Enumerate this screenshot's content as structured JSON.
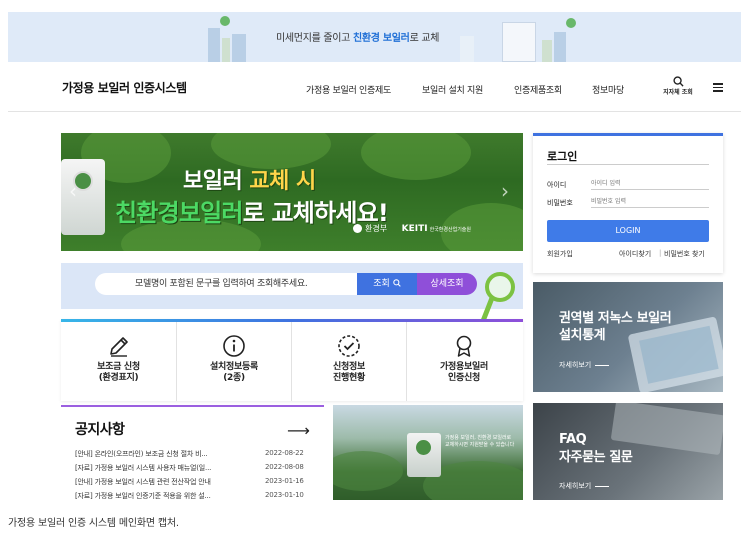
{
  "top_banner": {
    "text_prefix": "미세먼지를 줄이고 ",
    "text_highlight": "친환경 보일러",
    "text_suffix": "로 교체"
  },
  "header": {
    "logo": "가정용 보일러 인증시스템",
    "nav": [
      "가정용 보일러 인증제도",
      "보일러 설치 지원",
      "인증제품조회",
      "정보마당"
    ],
    "search_label": "지자체 조회"
  },
  "hero": {
    "line1_a": "보일러 ",
    "line1_b": "교체 시",
    "line2_a": "친환경보일러",
    "line2_b": "로 교체하세요!",
    "ministry": "환경부",
    "keiti": "KEITI",
    "keiti_sub": "한국환경산업기술원",
    "prev_arrow": "‹",
    "next_arrow": "›"
  },
  "search_strip": {
    "placeholder": "모델명이 포함된 문구를 입력하여 조회해주세요.",
    "search_button": "조회",
    "detail_button": "상세조회"
  },
  "quick_menu": [
    {
      "line1": "보조금 신청",
      "line2": "(환경표지)"
    },
    {
      "line1": "설치정보등록",
      "line2": "(2종)"
    },
    {
      "line1": "신청정보",
      "line2": "진행현황"
    },
    {
      "line1": "가정용보일러",
      "line2": "인증신청"
    }
  ],
  "notice": {
    "title": "공지사항",
    "arrow": "⟶",
    "items": [
      {
        "title": "[안내] 온라인(오프라인) 보조금 신청 절차 비...",
        "date": "2022-08-22"
      },
      {
        "title": "[자료] 가정용 보일러 시스템 사용자 매뉴얼(일...",
        "date": "2022-08-08"
      },
      {
        "title": "[안내] 가정용 보일러 시스템 관련 전산작업 안내",
        "date": "2023-01-16"
      },
      {
        "title": "[자료] 가정용 보일러 인증기준 적용을 위한 설...",
        "date": "2023-01-10"
      }
    ]
  },
  "promo": {
    "line1": "가정용 보일러, 친환경 보일러로",
    "line2": "교체하시면 지원받을 수 있습니다"
  },
  "login": {
    "title": "로그인",
    "id_label": "아이디",
    "id_placeholder": "아이디 입력",
    "pw_label": "비밀번호",
    "pw_placeholder": "비밀번호 입력",
    "button": "LOGIN",
    "signup": "회원가입",
    "find_id": "아이디찾기",
    "find_pw": "비밀번호 찾기"
  },
  "cards": [
    {
      "line1": "권역별 저녹스 보일러",
      "line2": "설치통계",
      "more": "자세히보기"
    },
    {
      "line1": "FAQ",
      "line2": "자주묻는 질문",
      "more": "자세히보기"
    }
  ],
  "caption": "가정용 보일러 인증 시스템 메인화면 캡처."
}
